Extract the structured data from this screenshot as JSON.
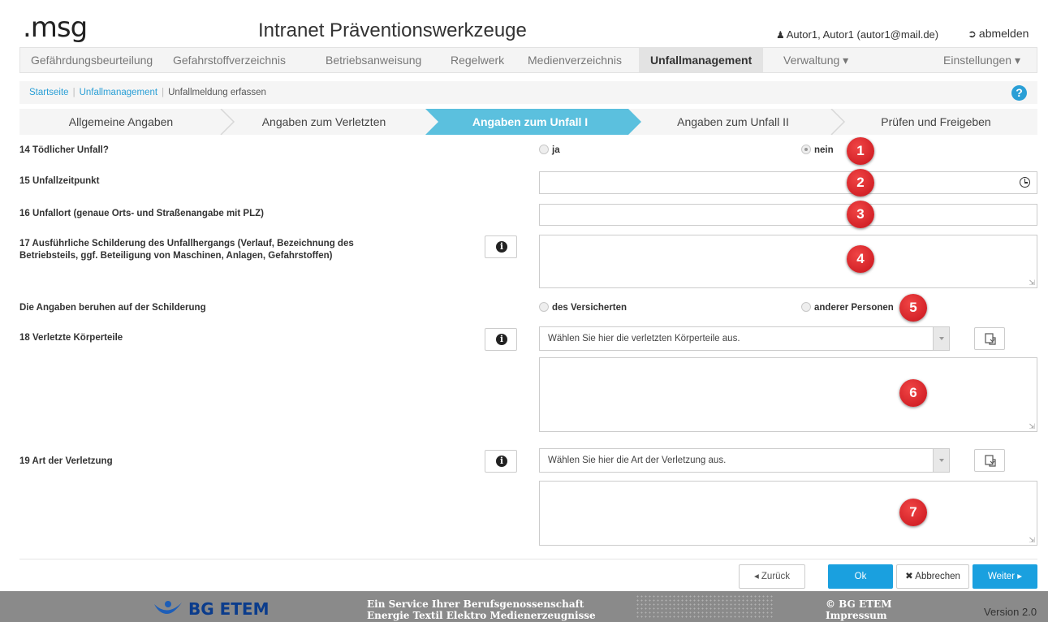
{
  "header": {
    "logo": ".msg",
    "app_title": "Intranet Präventionswerkzeuge",
    "user": "Autor1, Autor1 (autor1@mail.de)",
    "logout": "abmelden"
  },
  "nav": {
    "items": [
      "Gefährdungsbeurteilung",
      "Gefahrstoffverzeichnis",
      "Betriebsanweisung",
      "Regelwerk",
      "Medienverzeichnis",
      "Unfallmanagement",
      "Verwaltung ▾",
      "Einstellungen ▾"
    ],
    "active": "Unfallmanagement"
  },
  "breadcrumb": [
    "Startseite",
    "Unfallmanagement",
    "Unfallmeldung erfassen"
  ],
  "steps": [
    "Allgemeine Angaben",
    "Angaben zum Verletzten",
    "Angaben zum Unfall I",
    "Angaben zum Unfall II",
    "Prüfen und Freigeben"
  ],
  "active_step": "Angaben zum Unfall I",
  "form": {
    "q14": {
      "label": "14 Tödlicher Unfall?",
      "opt_yes": "ja",
      "opt_no": "nein",
      "selected": "nein"
    },
    "q15": {
      "label": "15 Unfallzeitpunkt",
      "value": ""
    },
    "q16": {
      "label": "16 Unfallort (genaue Orts- und Straßenangabe mit PLZ)",
      "value": ""
    },
    "q17": {
      "label_line1": "17 Ausführliche Schilderung des Unfallhergangs (Verlauf, Bezeichnung des",
      "label_line2": "Betriebsteils, ggf. Beteiligung von Maschinen, Anlagen, Gefahrstoffen)",
      "value": ""
    },
    "source": {
      "label": "Die Angaben beruhen auf der Schilderung",
      "opt_insured": "des Versicherten",
      "opt_others": "anderer Personen"
    },
    "q18": {
      "label": "18 Verletzte Körperteile",
      "placeholder": "Wählen Sie hier die verletzten Körperteile aus."
    },
    "q19": {
      "label": "19 Art der Verletzung",
      "placeholder": "Wählen Sie hier die Art der Verletzung aus."
    }
  },
  "badges": [
    "1",
    "2",
    "3",
    "4",
    "5",
    "6",
    "7"
  ],
  "buttons": {
    "back": "◂ Zurück",
    "ok": "Ok",
    "cancel": "Abbrechen",
    "next": "Weiter ▸"
  },
  "footer": {
    "logo": "BG ETEM",
    "service_line1": "Ein Service Ihrer Berufsgenossenschaft",
    "service_line2": "Energie Textil Elektro Medienerzeugnisse",
    "copyright": "© BG ETEM",
    "imprint": "Impressum",
    "version": "Version 2.0"
  },
  "colors": {
    "accent": "#1aa0df",
    "badge": "#d0181f",
    "active_step": "#5bc0de",
    "footer": "#8a8a8a"
  }
}
